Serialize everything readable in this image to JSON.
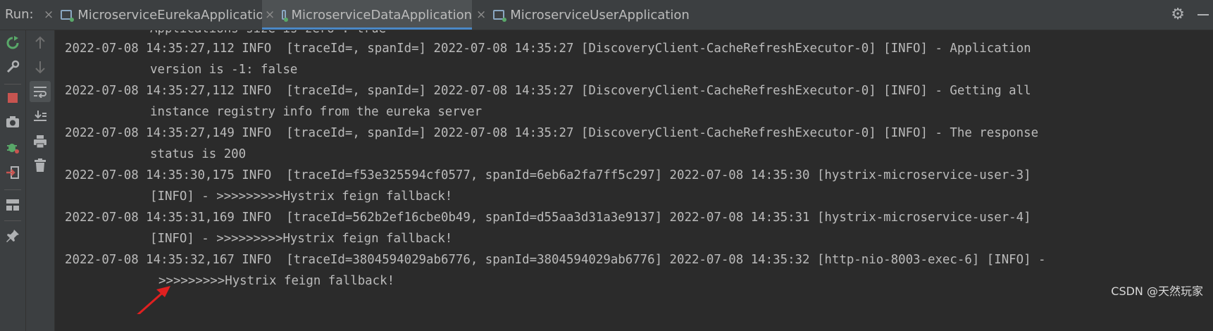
{
  "run_label": "Run:",
  "tabs": [
    {
      "label": "MicroserviceEurekaApplication",
      "close": "×",
      "active": false
    },
    {
      "label": "MicroserviceDataApplication",
      "close": "×",
      "active": true
    },
    {
      "label": "MicroserviceUserApplication",
      "close": "×",
      "active": false
    }
  ],
  "icons": {
    "settings": "gear-icon",
    "minimize": "minimize-icon",
    "rerun": "rerun-icon",
    "wrench": "wrench-icon",
    "stop": "stop-icon",
    "camera": "camera-icon",
    "debug": "debug-icon",
    "login": "login-icon",
    "layout": "layout-icon",
    "pin": "pin-icon",
    "up": "up-arrow-icon",
    "down": "down-arrow-icon",
    "softwrap": "soft-wrap-icon",
    "scrollend": "scroll-to-end-icon",
    "print": "print-icon",
    "trash": "trash-icon"
  },
  "console": {
    "lines": [
      {
        "text": "Applications size is zero : true",
        "cont": true
      },
      {
        "text": "2022-07-08 14:35:27,112 INFO  [traceId=, spanId=] 2022-07-08 14:35:27 [DiscoveryClient-CacheRefreshExecutor-0] [INFO] - Application",
        "cont": false
      },
      {
        "text": "version is -1: false",
        "cont": true
      },
      {
        "text": "2022-07-08 14:35:27,112 INFO  [traceId=, spanId=] 2022-07-08 14:35:27 [DiscoveryClient-CacheRefreshExecutor-0] [INFO] - Getting all",
        "cont": false
      },
      {
        "text": "instance registry info from the eureka server",
        "cont": true
      },
      {
        "text": "2022-07-08 14:35:27,149 INFO  [traceId=, spanId=] 2022-07-08 14:35:27 [DiscoveryClient-CacheRefreshExecutor-0] [INFO] - The response",
        "cont": false
      },
      {
        "text": "status is 200",
        "cont": true
      },
      {
        "text": "2022-07-08 14:35:30,175 INFO  [traceId=f53e325594cf0577, spanId=6eb6a2fa7ff5c297] 2022-07-08 14:35:30 [hystrix-microservice-user-3]",
        "cont": false
      },
      {
        "text": "[INFO] - >>>>>>>>>Hystrix feign fallback!",
        "cont": true
      },
      {
        "text": "2022-07-08 14:35:31,169 INFO  [traceId=562b2ef16cbe0b49, spanId=d55aa3d31a3e9137] 2022-07-08 14:35:31 [hystrix-microservice-user-4]",
        "cont": false
      },
      {
        "text": "[INFO] - >>>>>>>>>Hystrix feign fallback!",
        "cont": true
      },
      {
        "text": "2022-07-08 14:35:32,167 INFO  [traceId=3804594029ab6776, spanId=3804594029ab6776] 2022-07-08 14:35:32 [http-nio-8003-exec-6] [INFO] -",
        "cont": false
      },
      {
        "text": ">>>>>>>>>Hystrix feign fallback!",
        "cont": true
      }
    ]
  },
  "annotation_color": "#e02020",
  "watermark": "CSDN @天然玩家"
}
